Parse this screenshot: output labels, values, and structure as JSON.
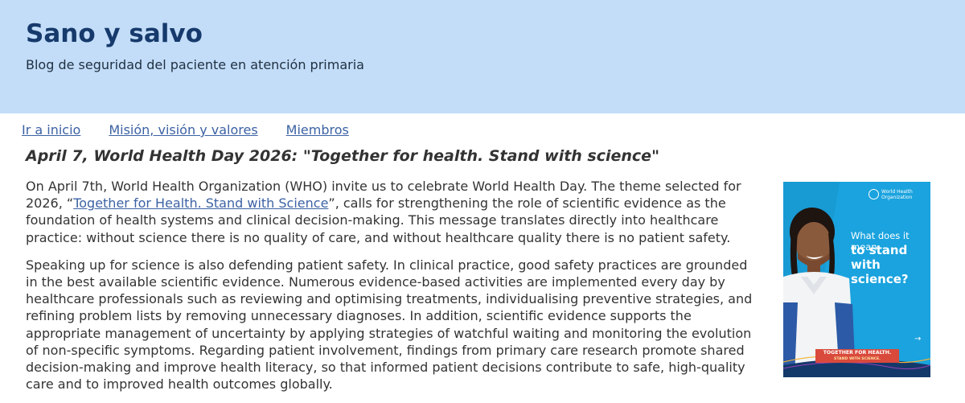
{
  "header": {
    "title": "Sano y salvo",
    "description": "Blog de seguridad del paciente en atención primaria"
  },
  "nav": {
    "items": [
      {
        "label": "Ir a inicio"
      },
      {
        "label": "Misión, visión y valores"
      },
      {
        "label": "Miembros"
      }
    ]
  },
  "post": {
    "title": "April 7, World Health Day 2026: \"Together for health. Stand with science\"",
    "p1_before": "On April 7th, World Health Organization (WHO) invite us to celebrate World Health Day. The theme selected for 2026, “",
    "p1_link": "Together for Health. Stand with Science",
    "p1_after": "”, calls for strengthening the role of scientific evidence as the foundation of health systems and clinical decision-making. This message translates directly into healthcare practice: without science there is no quality of care, and without healthcare quality there is no patient safety.",
    "p2": "Speaking up for science is also defending patient safety. In clinical practice, good safety practices are grounded in the best available scientific evidence. Numerous evidence-based activities are implemented every day by healthcare professionals such as reviewing and optimising treatments, individualising preventive strategies, and refining problem lists by removing unnecessary diagnoses. In addition, scientific evidence supports the appropriate management of uncertainty by applying strategies of watchful waiting and monitoring the evolution of non-specific symptoms. Regarding patient involvement, findings from primary care research promote shared decision-making and improve health literacy, so that informed patient decisions contribute to safe, high-quality care and to improved health outcomes globally."
  },
  "figure": {
    "logo_text": "World Health Organization",
    "question_top": "What does it mean",
    "question_bold": "to stand with science?",
    "banner_line1": "TOGETHER FOR HEALTH.",
    "banner_line2": "STAND WITH SCIENCE.",
    "arrow": "→",
    "colors": {
      "background": "#1aa3de",
      "banner": "#d94a3c"
    }
  }
}
